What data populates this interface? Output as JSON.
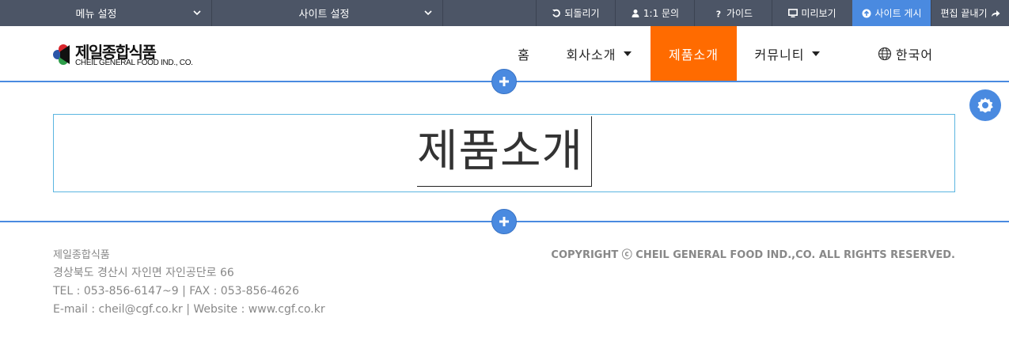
{
  "toolbar": {
    "menu_settings": "메뉴 설정",
    "site_settings": "사이트 설정",
    "undo": "되돌리기",
    "inquiry": "1:1 문의",
    "guide": "가이드",
    "preview": "미리보기",
    "publish": "사이트 게시",
    "exit_edit": "편집 끝내기"
  },
  "logo": {
    "korean": "제일종합식품",
    "english": "CHEIL GENERAL FOOD IND., CO."
  },
  "nav": {
    "items": [
      {
        "label": "홈"
      },
      {
        "label": "회사소개"
      },
      {
        "label": "제품소개"
      },
      {
        "label": "커뮤니티"
      },
      {
        "label": "한국어"
      }
    ],
    "active": "제품소개"
  },
  "main": {
    "title": "제품소개"
  },
  "footer": {
    "company": "제일종합식품",
    "address": "경상북도 경산시 자인면 자인공단로 66",
    "contact": "TEL : 053-856-6147~9 | FAX : 053-856-4626",
    "web": "E-mail : cheil@cgf.co.kr | Website : www.cgf.co.kr",
    "copyright": "COPYRIGHT ⓒ CHEIL GENERAL FOOD IND.,CO. ALL RIGHTS RESERVED."
  },
  "colors": {
    "toolbar_bg": "#4c5566",
    "accent_blue": "#4a8ae0",
    "active_nav": "#ff6b00"
  }
}
